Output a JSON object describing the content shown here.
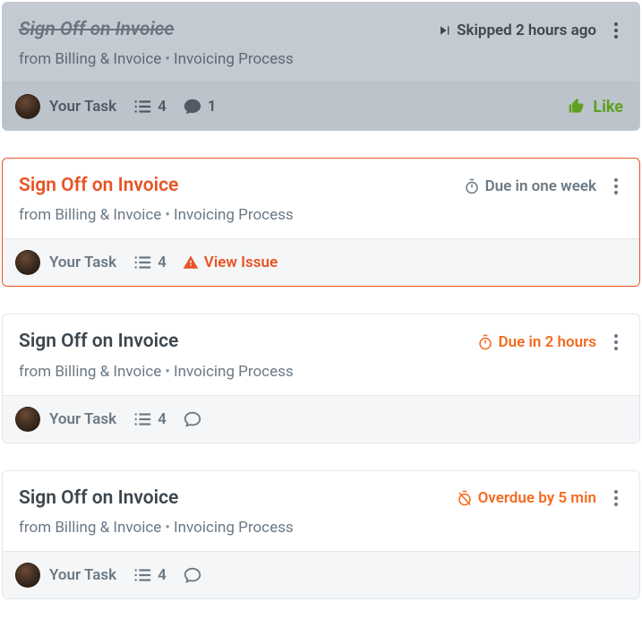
{
  "cards": [
    {
      "title": "Sign Off on Invoice",
      "source_prefix": "from ",
      "workspace": "Billing & Invoice",
      "process": "Invoicing Process",
      "status_text": "Skipped 2 hours ago",
      "owner_label": "Your Task",
      "checklist_count": "4",
      "comment_count": "1",
      "like_label": "Like"
    },
    {
      "title": "Sign Off on Invoice",
      "source_prefix": "from ",
      "workspace": "Billing & Invoice",
      "process": "Invoicing Process",
      "status_text": "Due in one week",
      "owner_label": "Your Task",
      "checklist_count": "4",
      "issue_label": "View Issue"
    },
    {
      "title": "Sign Off on Invoice",
      "source_prefix": "from ",
      "workspace": "Billing & Invoice",
      "process": "Invoicing Process",
      "status_text": "Due in 2 hours",
      "owner_label": "Your Task",
      "checklist_count": "4"
    },
    {
      "title": "Sign Off on Invoice",
      "source_prefix": "from ",
      "workspace": "Billing & Invoice",
      "process": "Invoicing Process",
      "status_text": "Overdue by 5 min",
      "owner_label": "Your Task",
      "checklist_count": "4"
    }
  ]
}
